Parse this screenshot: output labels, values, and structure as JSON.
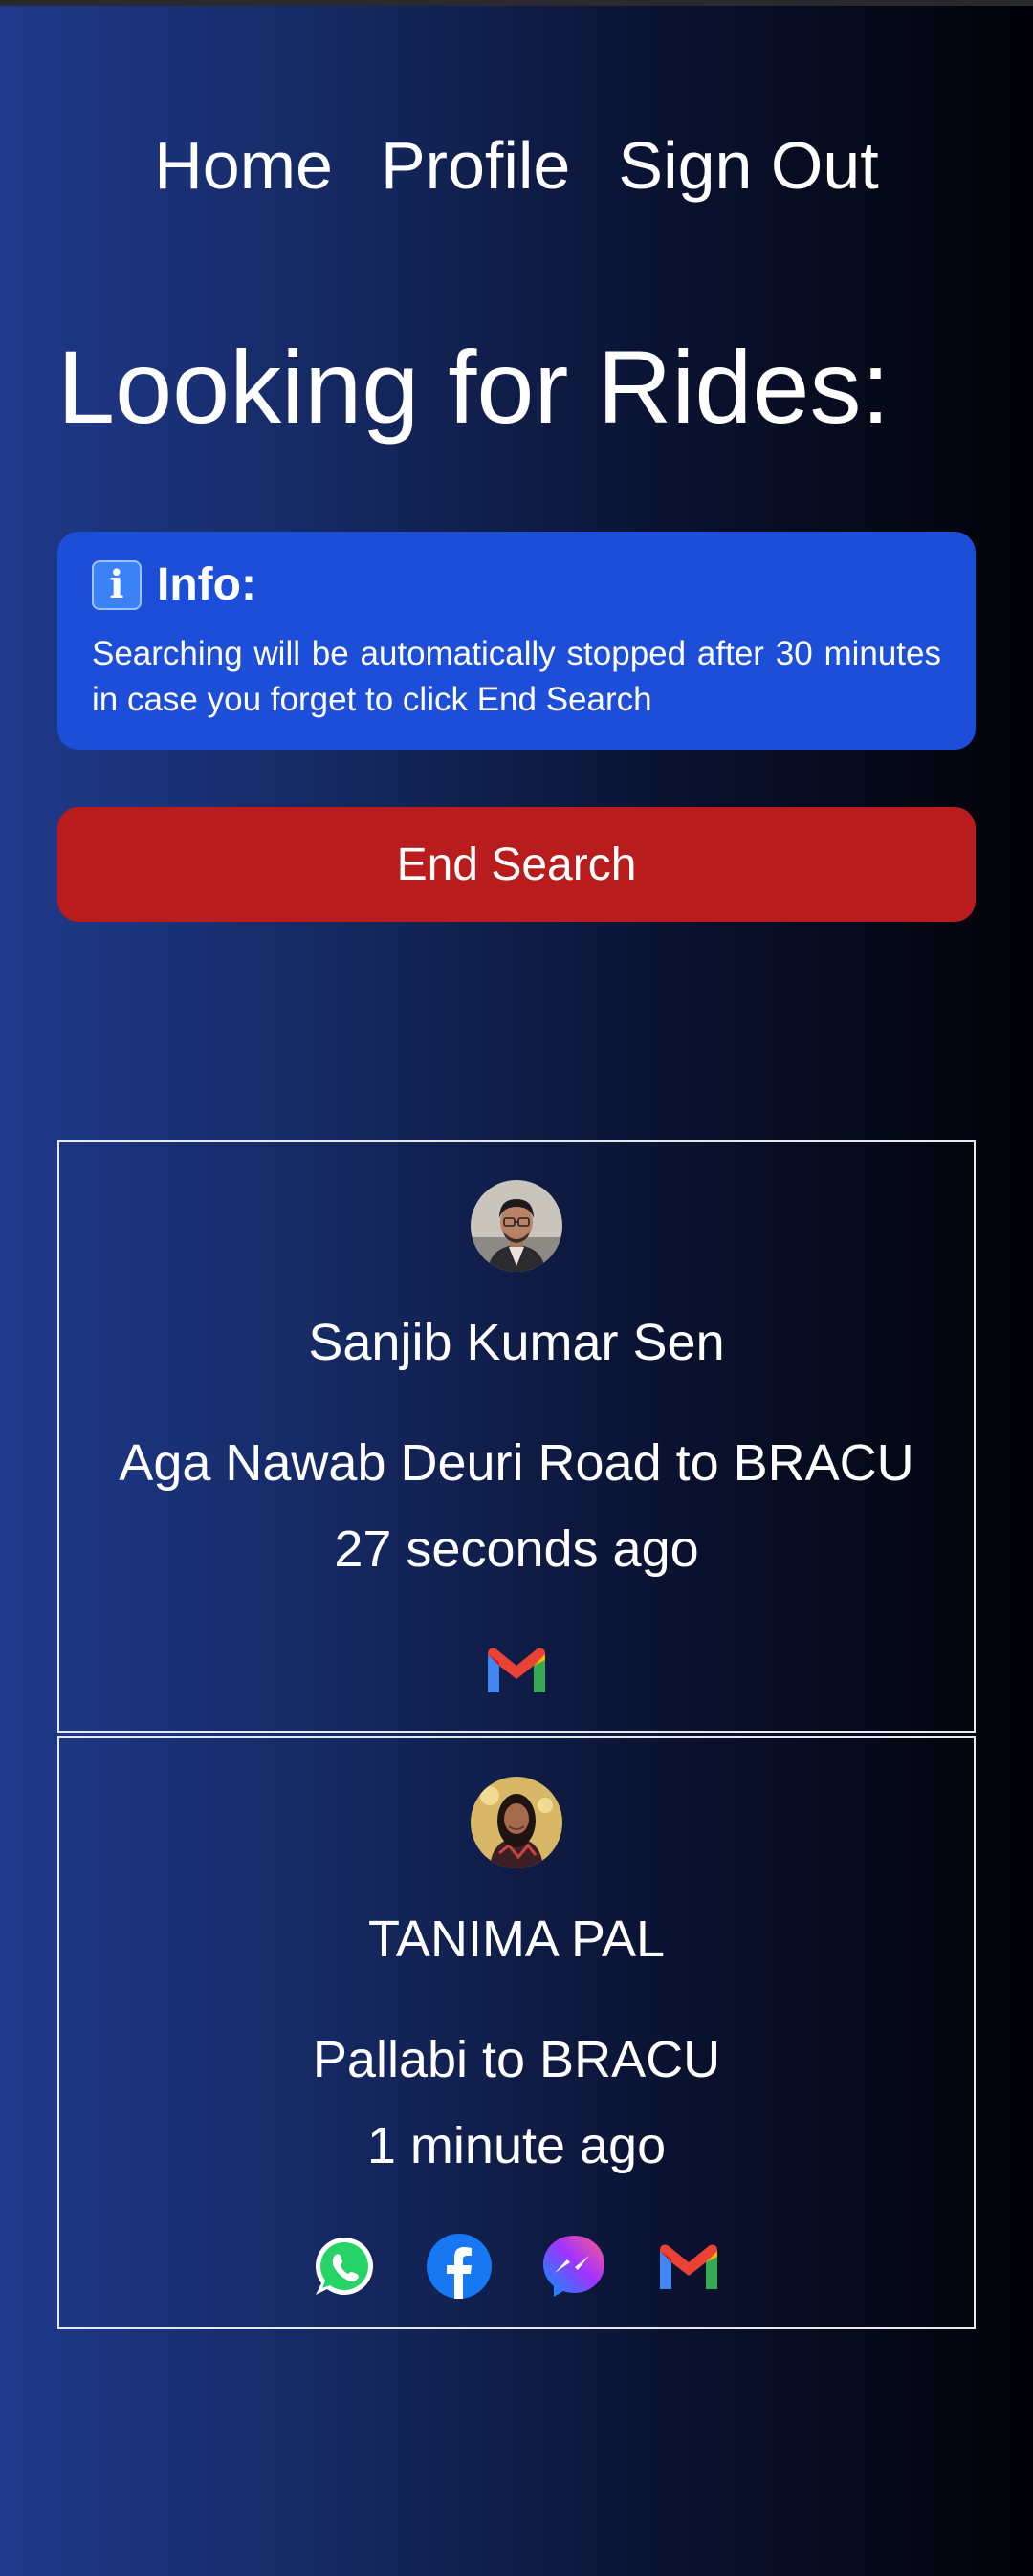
{
  "nav": {
    "home": "Home",
    "profile": "Profile",
    "sign_out": "Sign Out"
  },
  "page_title": "Looking for Rides:",
  "info": {
    "icon": "info-icon",
    "icon_glyph": "i",
    "title": "Info:",
    "text": "Searching will be automatically stopped after 30 minutes in case you forget to click End Search"
  },
  "end_search_label": "End Search",
  "rides": [
    {
      "name": "Sanjib Kumar Sen",
      "route": "Aga Nawab Deuri Road to BRACU",
      "time_ago": "27 seconds ago",
      "contacts": [
        "gmail-icon"
      ]
    },
    {
      "name": "TANIMA PAL",
      "route": "Pallabi to BRACU",
      "time_ago": "1 minute ago",
      "contacts": [
        "whatsapp-icon",
        "facebook-icon",
        "messenger-icon",
        "gmail-icon"
      ]
    }
  ],
  "colors": {
    "info_bg": "#1d4ed8",
    "end_button_bg": "#b91c1c",
    "card_border": "#e5e7eb",
    "whatsapp": "#25d366",
    "facebook": "#1877f2",
    "messenger": "#a334fa"
  }
}
